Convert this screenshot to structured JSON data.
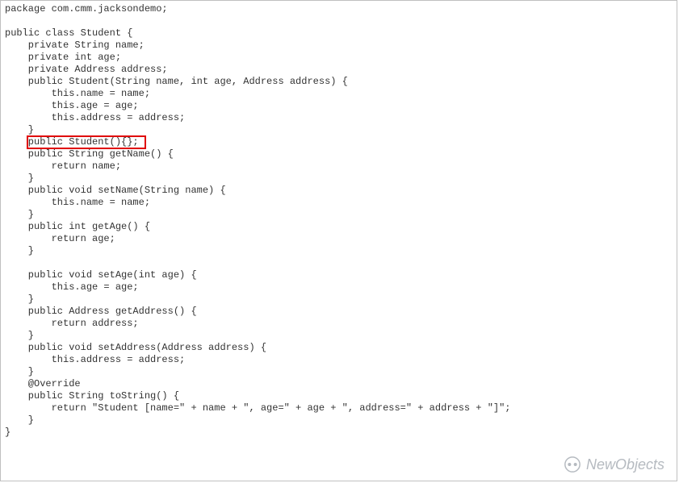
{
  "code": {
    "lines": [
      "package com.cmm.jacksondemo;",
      "",
      "public class Student {",
      "    private String name;",
      "    private int age;",
      "    private Address address;",
      "    public Student(String name, int age, Address address) {",
      "        this.name = name;",
      "        this.age = age;",
      "        this.address = address;",
      "    }",
      "    public Student(){};",
      "    public String getName() {",
      "        return name;",
      "    }",
      "    public void setName(String name) {",
      "        this.name = name;",
      "    }",
      "    public int getAge() {",
      "        return age;",
      "    }",
      "",
      "    public void setAge(int age) {",
      "        this.age = age;",
      "    }",
      "    public Address getAddress() {",
      "        return address;",
      "    }",
      "    public void setAddress(Address address) {",
      "        this.address = address;",
      "    }",
      "    @Override",
      "    public String toString() {",
      "        return \"Student [name=\" + name + \", age=\" + age + \", address=\" + address + \"]\";",
      "    }",
      "}"
    ]
  },
  "highlight": {
    "target_line_index": 11,
    "left_chars": 4,
    "width_chars": 20
  },
  "watermark": {
    "text": "NewObjects"
  }
}
